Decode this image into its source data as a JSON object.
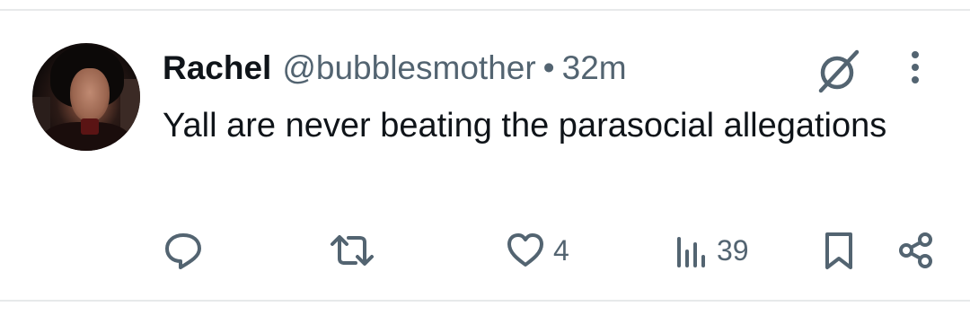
{
  "tweet": {
    "author_name": "Rachel",
    "handle": "@bubblesmother",
    "separator": "•",
    "time": "32m",
    "text": "Yall are never beating the parasocial allegations"
  },
  "actions": {
    "reply": {
      "icon": "reply-icon"
    },
    "retweet": {
      "icon": "retweet-icon"
    },
    "like": {
      "icon": "heart-icon",
      "count": "4"
    },
    "views": {
      "icon": "views-icon",
      "count": "39"
    },
    "bookmark": {
      "icon": "bookmark-icon"
    },
    "share": {
      "icon": "share-icon"
    }
  },
  "colors": {
    "primary_text": "#0f1419",
    "secondary_text": "#536471",
    "divider": "#e7e9ea"
  }
}
